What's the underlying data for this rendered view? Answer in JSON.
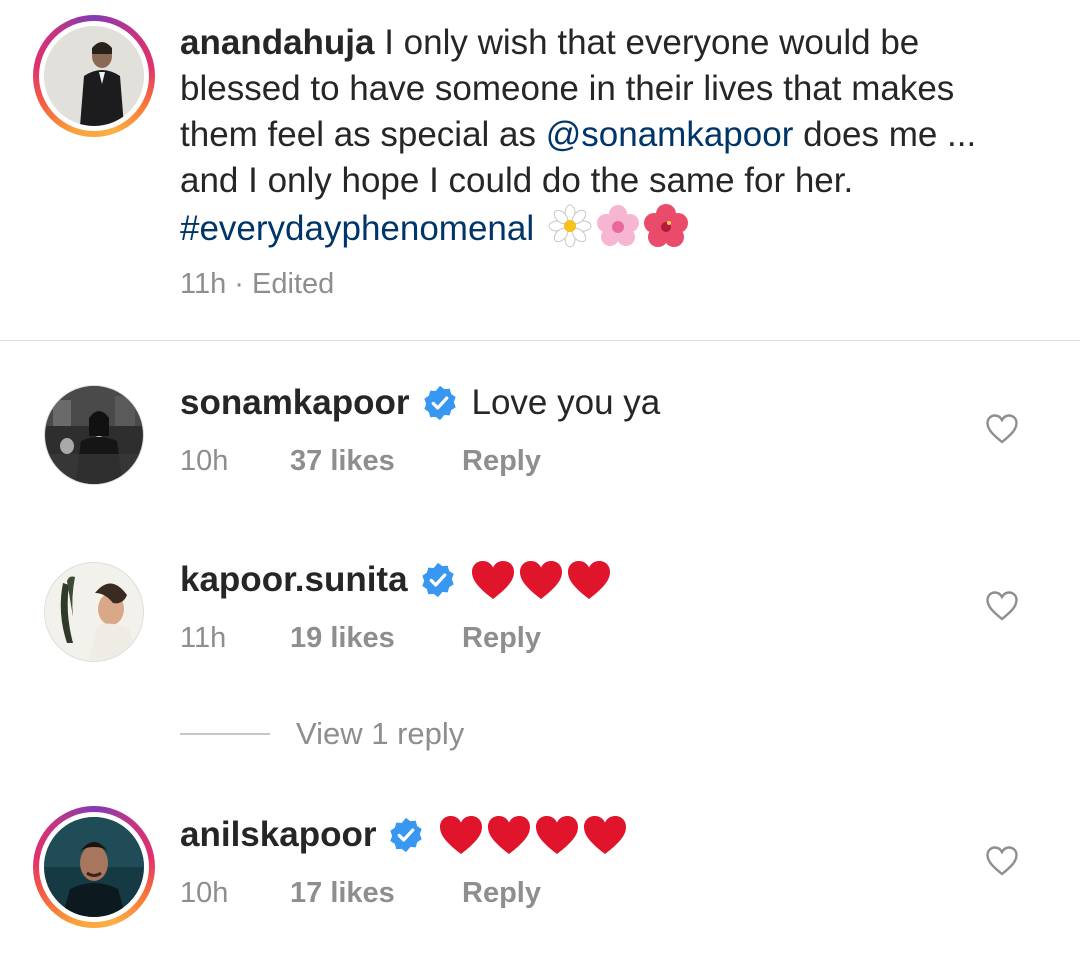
{
  "caption": {
    "username": "anandahuja",
    "text_before_mention": "I only wish that everyone would be blessed to have someone in their lives that makes them feel as special as",
    "mention": "@sonamkapoor",
    "text_after_mention": "does me ... and I only hope I could do the same for her.",
    "hashtag": "#everydayphenomenal",
    "emojis": [
      "daisy-emoji",
      "cherry-blossom-emoji",
      "hibiscus-emoji"
    ],
    "time": "11h",
    "separator": "·",
    "edited": "Edited"
  },
  "comments": [
    {
      "username": "sonamkapoor",
      "verified": true,
      "text": "Love you ya",
      "time": "10h",
      "likes": "37 likes",
      "reply": "Reply"
    },
    {
      "username": "kapoor.sunita",
      "verified": true,
      "text": "",
      "hearts": 3,
      "time": "11h",
      "likes": "19 likes",
      "reply": "Reply"
    },
    {
      "username": "anilskapoor",
      "verified": true,
      "text": "",
      "hearts": 4,
      "time": "10h",
      "likes": "17 likes",
      "reply": "Reply"
    }
  ],
  "view_replies": "View 1 reply",
  "colors": {
    "link": "#003569",
    "meta": "#8e8e8e",
    "verified": "#3897f0",
    "heart": "#e0142b"
  }
}
